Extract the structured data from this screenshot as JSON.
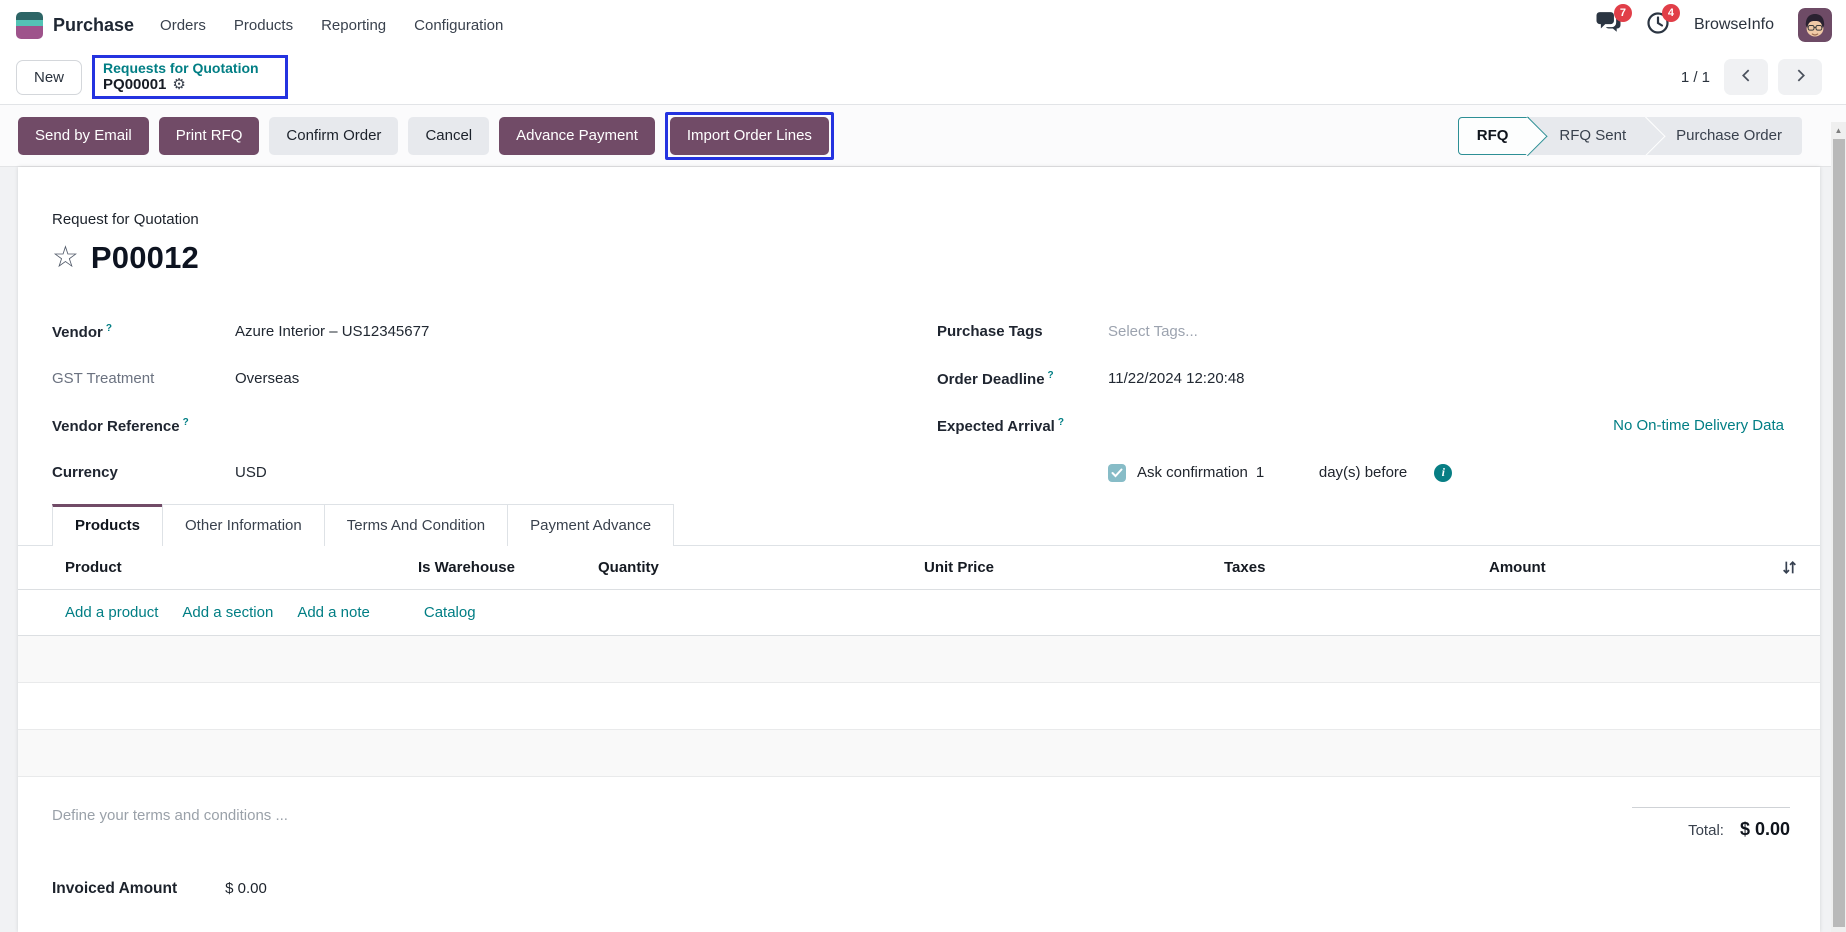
{
  "nav": {
    "app_title": "Purchase",
    "menus": [
      "Orders",
      "Products",
      "Reporting",
      "Configuration"
    ],
    "messages_badge": "7",
    "activities_badge": "4",
    "user_name": "BrowseInfo"
  },
  "breadcrumb": {
    "new_label": "New",
    "parent": "Requests for Quotation",
    "current": "PQ00001",
    "pager": "1 / 1"
  },
  "actions": {
    "buttons": [
      {
        "label": "Send by Email"
      },
      {
        "label": "Print RFQ"
      },
      {
        "label": "Confirm Order"
      },
      {
        "label": "Cancel"
      },
      {
        "label": "Advance Payment"
      },
      {
        "label": "Import Order Lines"
      }
    ]
  },
  "statusbar": {
    "steps": [
      "RFQ",
      "RFQ Sent",
      "Purchase Order"
    ],
    "active_step": "RFQ"
  },
  "form": {
    "doc_type": "Request for Quotation",
    "record_name": "P00012",
    "help_marker": "?",
    "left_fields": [
      {
        "label": "Vendor",
        "value": "Azure Interior – US12345677"
      },
      {
        "label": "GST Treatment",
        "value": "Overseas"
      },
      {
        "label": "Vendor Reference",
        "value": ""
      },
      {
        "label": "Currency",
        "value": "USD"
      }
    ],
    "right_fields": [
      {
        "label": "Purchase Tags",
        "placeholder": "Select Tags..."
      },
      {
        "label": "Order Deadline",
        "value": "11/22/2024 12:20:48"
      },
      {
        "label": "Expected Arrival",
        "value": ""
      }
    ],
    "delivery_link": "No On-time Delivery Data",
    "ask_confirmation": {
      "label": "Ask confirmation",
      "value": "1",
      "suffix": "day(s) before"
    }
  },
  "tabs": [
    "Products",
    "Other Information",
    "Terms And Condition",
    "Payment Advance"
  ],
  "order_lines": {
    "columns": [
      "Product",
      "Is Warehouse",
      "Quantity",
      "Unit Price",
      "Taxes",
      "Amount"
    ],
    "add_links": [
      "Add a product",
      "Add a section",
      "Add a note"
    ],
    "catalog_link": "Catalog",
    "rows": []
  },
  "footer": {
    "terms_placeholder": "Define your terms and conditions ...",
    "total_label": "Total:",
    "total_value": "$ 0.00",
    "invoiced_label": "Invoiced Amount",
    "invoiced_value": "$ 0.00"
  },
  "icons": {
    "gear": "⚙",
    "star": "☆",
    "info": "i",
    "scroll_up": "▲"
  },
  "colors": {
    "primary_purple": "#714B67",
    "link_teal": "#017E84",
    "badge_red": "#E13E48",
    "highlight_blue": "#2433E0",
    "checkbox_teal": "#87BCC7"
  }
}
